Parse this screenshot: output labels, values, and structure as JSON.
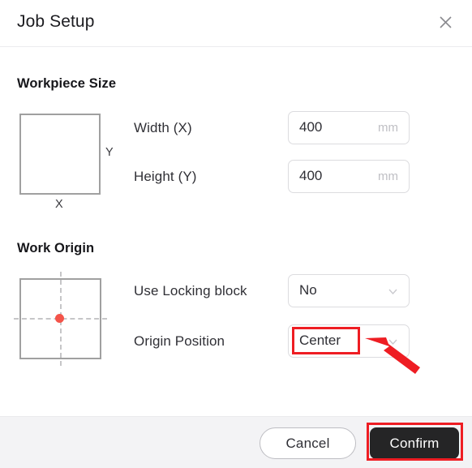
{
  "header": {
    "title": "Job Setup",
    "close_icon": "close-icon"
  },
  "sections": {
    "workpiece": {
      "title": "Workpiece Size",
      "diagram": {
        "x_axis_label": "X",
        "y_axis_label": "Y"
      },
      "fields": [
        {
          "label": "Width (X)",
          "value": "400",
          "unit": "mm"
        },
        {
          "label": "Height (Y)",
          "value": "400",
          "unit": "mm"
        }
      ]
    },
    "work_origin": {
      "title": "Work Origin",
      "diagram": {
        "origin_marker": "origin-dot",
        "marker_color": "#f4544a"
      },
      "fields": [
        {
          "label": "Use Locking block",
          "value": "No",
          "icon": "chevron-down-icon"
        },
        {
          "label": "Origin Position",
          "value": "Center",
          "icon": "chevron-down-icon"
        }
      ]
    }
  },
  "footer": {
    "cancel_label": "Cancel",
    "confirm_label": "Confirm"
  },
  "annotations": {
    "color": "#ee1d23",
    "highlight_origin_position": "Center",
    "highlight_confirm": "Confirm",
    "arrow": "red-arrow-pointing-to-origin-position"
  }
}
